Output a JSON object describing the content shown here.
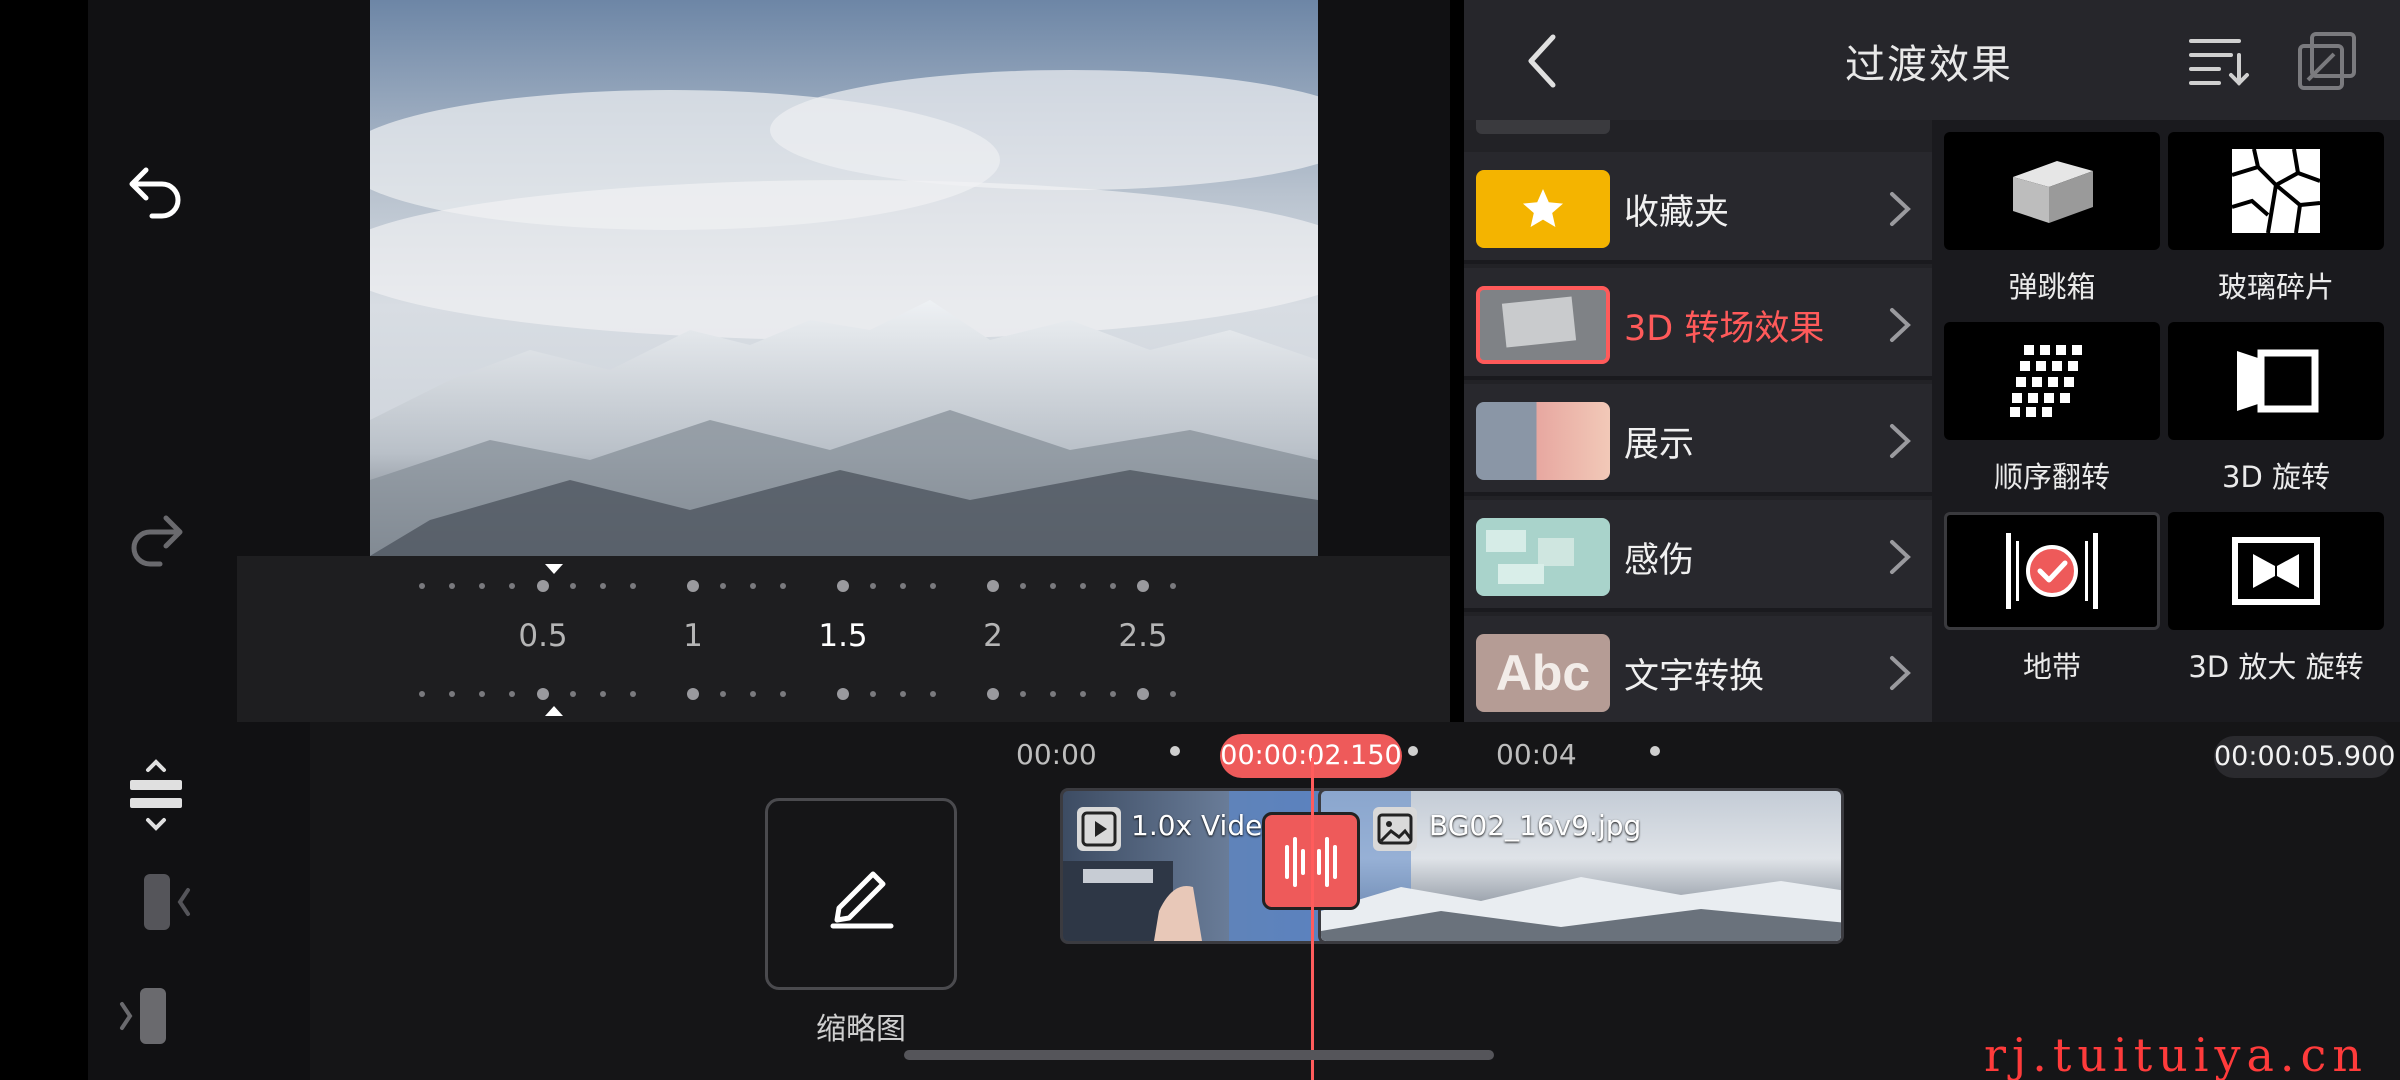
{
  "panel": {
    "title": "过渡效果",
    "categories": [
      {
        "label": "收藏夹",
        "active": false
      },
      {
        "label": "3D 转场效果",
        "active": true
      },
      {
        "label": "展示",
        "active": false
      },
      {
        "label": "感伤",
        "active": false
      },
      {
        "label": "文字转换",
        "active": false
      }
    ],
    "category_thumb_text": "Abc",
    "effects": [
      {
        "label": "弹跳箱",
        "icon": "glass-box-icon"
      },
      {
        "label": "玻璃碎片",
        "icon": "glass-shatter-icon"
      },
      {
        "label": "顺序翻转",
        "icon": "grid-flip-icon"
      },
      {
        "label": "3D 旋转",
        "icon": "3d-rotate-icon"
      },
      {
        "label": "地带",
        "icon": "zone-check-icon"
      },
      {
        "label": "3D 放大 旋转",
        "icon": "3d-zoom-rotate-icon"
      }
    ]
  },
  "speed_ruler": {
    "labels": [
      "0.5",
      "1",
      "1.5",
      "2",
      "2.5"
    ],
    "selected": "1.5"
  },
  "timeline": {
    "ticks": [
      "00:00",
      "00:04"
    ],
    "playhead_time": "00:00:02.150",
    "duration": "00:00:05.900",
    "thumbnail_label": "缩略图",
    "clips": [
      {
        "label": "1.0x Video"
      },
      {
        "label": "BG02_16v9.jpg"
      }
    ]
  },
  "watermark": "rj.tuituiya.cn",
  "colors": {
    "accent": "#ee5a5a",
    "favorite_yellow": "#f4b400",
    "panel_bg": "#1a1a1e"
  }
}
